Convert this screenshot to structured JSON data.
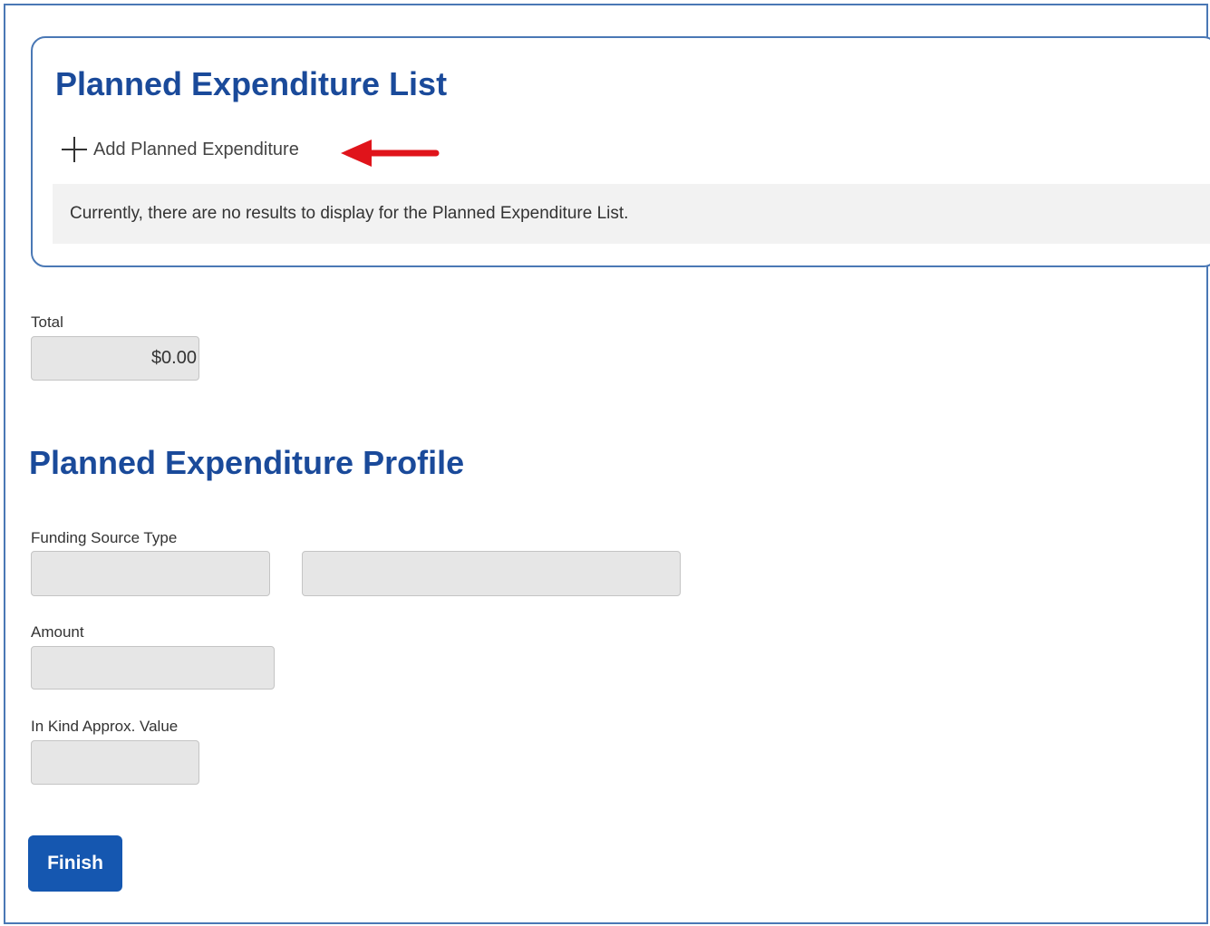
{
  "list_section": {
    "title": "Planned Expenditure List",
    "add_label": "Add Planned Expenditure",
    "empty_message": "Currently, there are no results to display for the Planned Expenditure List."
  },
  "total": {
    "label": "Total",
    "value": "$0.00"
  },
  "profile_section": {
    "title": "Planned Expenditure Profile",
    "funding_source_type_label": "Funding Source Type",
    "funding_source_type_value": "",
    "funding_source_detail_value": "",
    "amount_label": "Amount",
    "amount_value": "",
    "in_kind_label": "In Kind Approx. Value",
    "in_kind_value": ""
  },
  "finish_label": "Finish",
  "colors": {
    "heading": "#1a4a9a",
    "primary_button": "#1557b0",
    "annotation_arrow": "#e0141b",
    "border": "#4a78b5"
  },
  "icons": [
    "plus-icon",
    "red-arrow-annotation"
  ]
}
